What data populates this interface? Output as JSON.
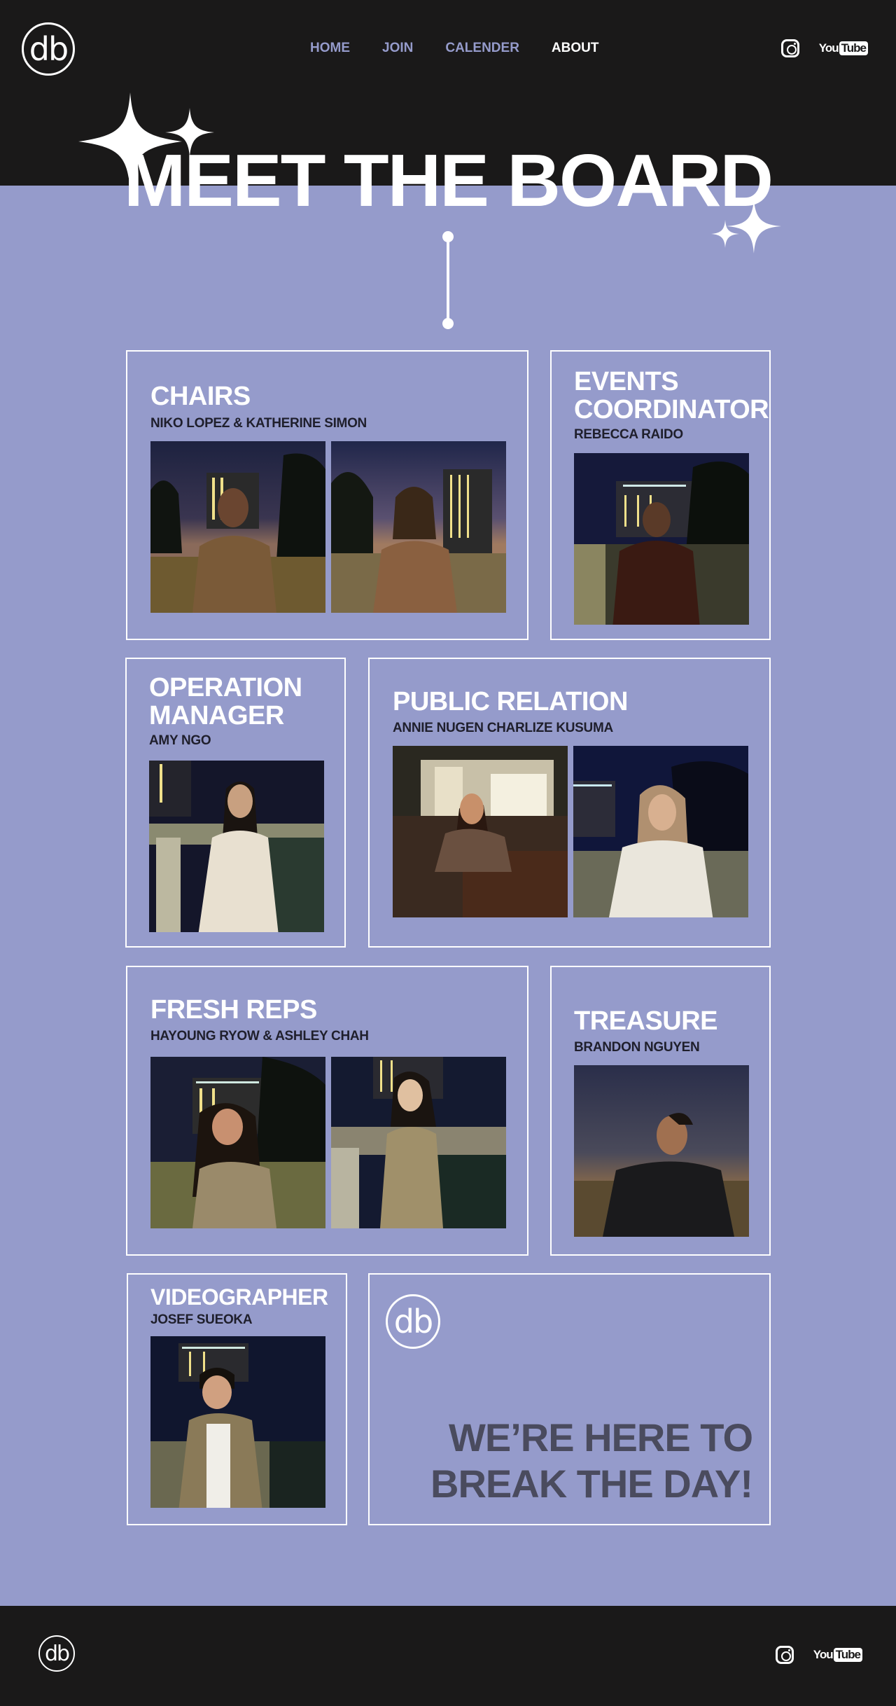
{
  "header": {
    "logo_text": "db",
    "nav": [
      {
        "label": "HOME",
        "active": false
      },
      {
        "label": "JOIN",
        "active": false
      },
      {
        "label": "CALENDER",
        "active": false
      },
      {
        "label": "ABOUT",
        "active": true
      }
    ],
    "social": {
      "instagram": "instagram-icon",
      "youtube_you": "You",
      "youtube_tube": "Tube"
    }
  },
  "hero": {
    "title": "MEET THE BOARD"
  },
  "cards": {
    "chairs": {
      "title": "CHAIRS",
      "names": "NIKO LOPEZ & KATHERINE SIMON"
    },
    "events": {
      "title_line1": "EVENTS",
      "title_line2": "COORDINATOR",
      "names": "REBECCA RAIDO"
    },
    "operation": {
      "title_line1": "OPERATION",
      "title_line2": "MANAGER",
      "names": "AMY NGO"
    },
    "public_relation": {
      "title": "PUBLIC RELATION",
      "names": "ANNIE NUGEN CHARLIZE KUSUMA"
    },
    "fresh_reps": {
      "title": "FRESH REPS",
      "names": "HAYOUNG RYOW & ASHLEY CHAH"
    },
    "treasure": {
      "title": "TREASURE",
      "names": "BRANDON NGUYEN"
    },
    "videographer": {
      "title": "VIDEOGRAPHER",
      "names": "JOSEF SUEOKA"
    },
    "promo": {
      "logo_text": "db",
      "tagline_line1": "WE’RE HERE TO",
      "tagline_line2": "BREAK THE DAY!"
    }
  },
  "footer": {
    "logo_text": "db",
    "youtube_you": "You",
    "youtube_tube": "Tube"
  },
  "colors": {
    "page_bg": "#959bcb",
    "header_bg": "#1a1919",
    "nav_inactive": "#959bcb",
    "tagline": "#4a4b5e"
  }
}
